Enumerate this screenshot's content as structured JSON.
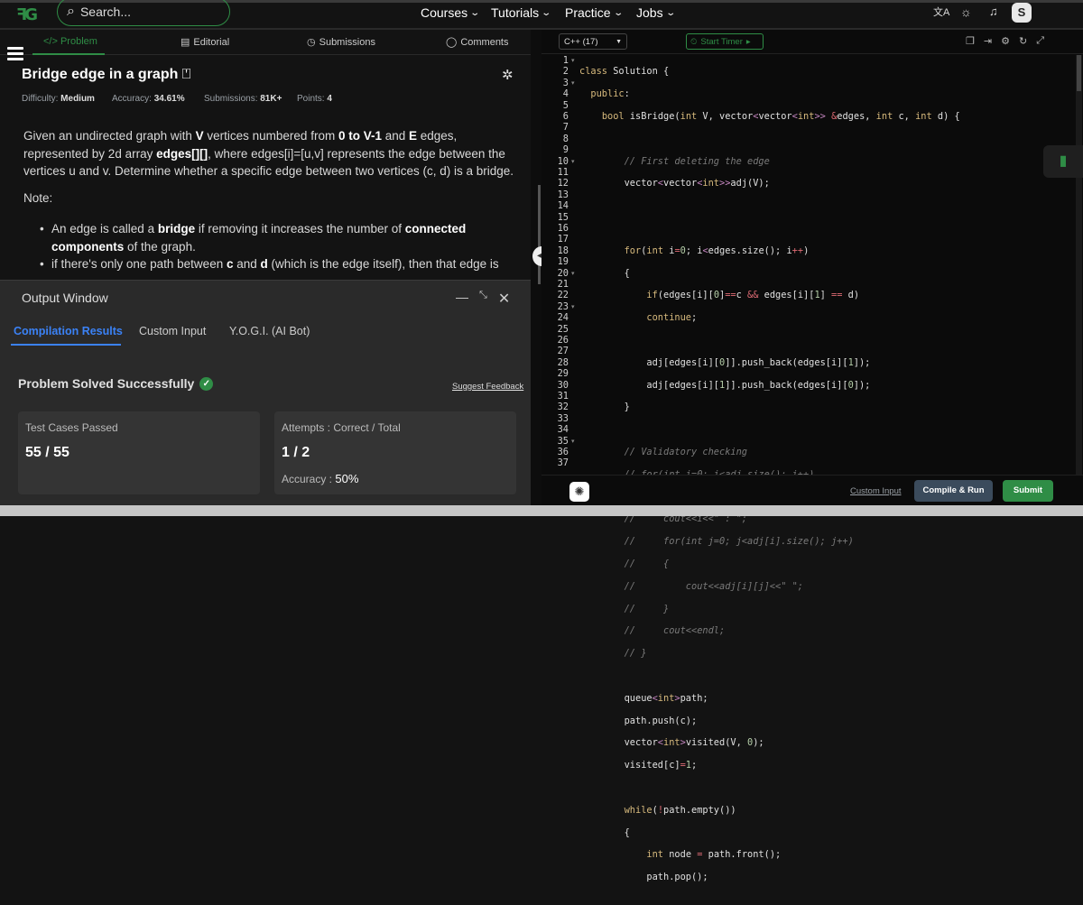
{
  "header": {
    "search_placeholder": "Search...",
    "nav": [
      {
        "label": "Courses"
      },
      {
        "label": "Tutorials"
      },
      {
        "label": "Practice"
      },
      {
        "label": "Jobs"
      }
    ],
    "avatar_letter": "S"
  },
  "left": {
    "tabs": [
      {
        "label": "</> Problem"
      },
      {
        "label": "Editorial"
      },
      {
        "label": "Submissions"
      },
      {
        "label": "Comments"
      }
    ],
    "title": "Bridge edge in a graph",
    "meta": {
      "difficulty_label": "Difficulty:",
      "difficulty": "Medium",
      "accuracy_label": "Accuracy:",
      "accuracy": "34.61%",
      "submissions_label": "Submissions:",
      "submissions": "81K+",
      "points_label": "Points:",
      "points": "4"
    },
    "description": {
      "p1": "Given an undirected graph with ",
      "v": "V",
      "p2": " vertices numbered from ",
      "range": "0 to V-1",
      "p3": " and ",
      "e": "E",
      "p4": " edges, represented by 2d array ",
      "edges": "edges[][]",
      "p5": ", where edges[i]=[u,v] represents the edge between the vertices u and v. Determine whether a specific edge between two vertices (c, d) is a bridge."
    },
    "note_label": "Note:",
    "bullet1": {
      "a": "An edge is called a ",
      "b": "bridge",
      "c": " if removing it increases the number of ",
      "d": "connected components",
      "e": " of the graph."
    },
    "bullet2": {
      "a": "if there's only one path between ",
      "c": "c",
      "and": " and ",
      "d": "d",
      "e": " (which is the edge itself), then that edge is"
    }
  },
  "output": {
    "title": "Output Window",
    "tabs": [
      {
        "label": "Compilation Results"
      },
      {
        "label": "Custom Input"
      },
      {
        "label": "Y.O.G.I. (AI Bot)"
      }
    ],
    "status": "Problem Solved Successfully",
    "feedback": "Suggest Feedback",
    "tests_label": "Test Cases Passed",
    "tests_value": "55 / 55",
    "attempts_label": "Attempts : Correct / Total",
    "attempts_value": "1 / 2",
    "accuracy_label": "Accuracy : ",
    "accuracy_value": "50%"
  },
  "editor": {
    "language": "C++ (17)",
    "timer": "Start Timer",
    "custom_input": "Custom Input",
    "compile": "Compile & Run",
    "submit": "Submit"
  },
  "colors": {
    "brand_green": "#2f8d46",
    "accent_blue": "#3b82f6"
  }
}
